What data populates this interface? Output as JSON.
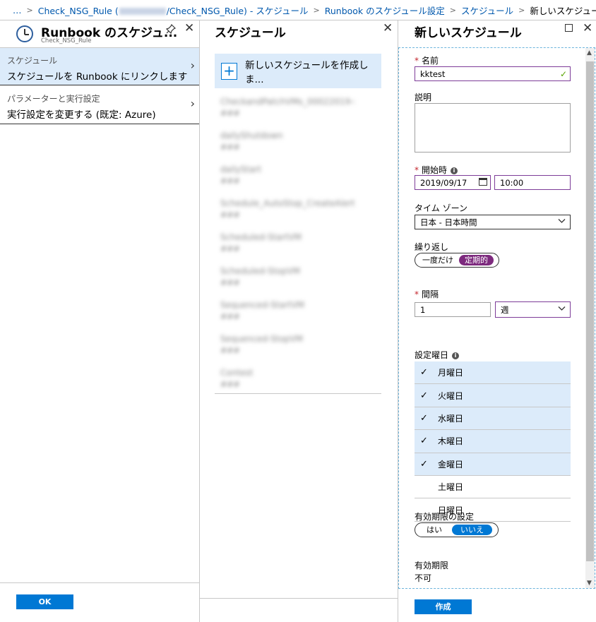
{
  "breadcrumb": {
    "ellipsis": "…",
    "items": [
      "Check_NSG_Rule (",
      "/Check_NSG_Rule) - スケジュール",
      "Runbook のスケジュール設定",
      "スケジュール",
      "新しいスケジュール"
    ],
    "sep": ">"
  },
  "panel1": {
    "title": "Runbook のスケジュ...",
    "subtitle": "Check_NSG_Rule",
    "pin_icon": "pin-icon",
    "close_icon": "close-icon",
    "items": [
      {
        "label": "スケジュール",
        "value": "スケジュールを Runbook にリンクします"
      },
      {
        "label": "パラメーターと実行設定",
        "value": "実行設定を変更する (既定: Azure)"
      }
    ],
    "ok_label": "OK"
  },
  "panel2": {
    "title": "スケジュール",
    "new_label": "新しいスケジュールを作成しま...",
    "schedules": [
      {
        "name": "CheckandPatchVMs_00022019-s",
        "detail": "###"
      },
      {
        "name": "dailyShutdown",
        "detail": "###"
      },
      {
        "name": "dailyStart",
        "detail": "###"
      },
      {
        "name": "Schedule_AutoStop_CreateAlert",
        "detail": "###"
      },
      {
        "name": "Scheduled-StartVM",
        "detail": "###"
      },
      {
        "name": "Scheduled-StopVM",
        "detail": "###"
      },
      {
        "name": "Sequenced-StartVM",
        "detail": "###"
      },
      {
        "name": "Sequenced-StopVM",
        "detail": "###"
      },
      {
        "name": "Contest",
        "detail": "###"
      }
    ]
  },
  "panel3": {
    "title": "新しいスケジュール",
    "name_label": "名前",
    "name_value": "kktest",
    "desc_label": "説明",
    "start_label": "開始時",
    "start_date": "2019/09/17",
    "start_time": "10:00",
    "tz_label": "タイム ゾーン",
    "tz_value": "日本 - 日本時間",
    "recur_label": "繰り返し",
    "recur_options": [
      "一度だけ",
      "定期的"
    ],
    "interval_label": "間隔",
    "interval_value": "1",
    "interval_unit": "週",
    "days_label": "設定曜日",
    "days": [
      {
        "name": "月曜日",
        "checked": true
      },
      {
        "name": "火曜日",
        "checked": true
      },
      {
        "name": "水曜日",
        "checked": true
      },
      {
        "name": "木曜日",
        "checked": true
      },
      {
        "name": "金曜日",
        "checked": true
      },
      {
        "name": "土曜日",
        "checked": false
      },
      {
        "name": "日曜日",
        "checked": false
      }
    ],
    "expire_set_label": "有効期限の設定",
    "expire_options": [
      "はい",
      "いいえ"
    ],
    "expire_label": "有効期限",
    "expire_value": "不可",
    "create_label": "作成",
    "required_mark": "*",
    "check_mark": "✓",
    "info_mark": "i"
  },
  "colors": {
    "accent": "#0078d4",
    "purple": "#7d2a7e",
    "selected_bg": "#dcebfa",
    "required": "#c4262e"
  }
}
